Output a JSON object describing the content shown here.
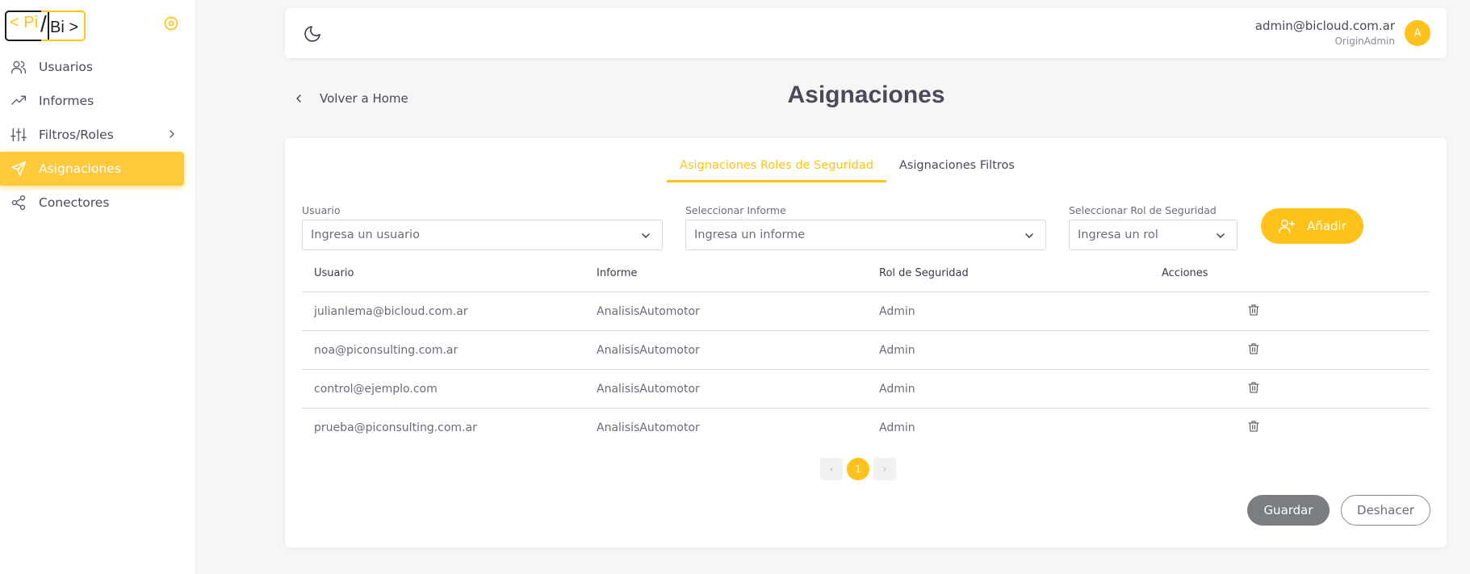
{
  "brand": {
    "logo_left": "< Pi",
    "logo_slash": "/",
    "logo_right": "Bi >",
    "accent_color": "#ffc21a"
  },
  "sidebar": {
    "items": [
      {
        "label": "Usuarios",
        "icon": "users-icon"
      },
      {
        "label": "Informes",
        "icon": "trending-up-icon"
      },
      {
        "label": "Filtros/Roles",
        "icon": "sliders-icon",
        "has_submenu": true
      },
      {
        "label": "Asignaciones",
        "icon": "send-icon",
        "active": true
      },
      {
        "label": "Conectores",
        "icon": "share-icon"
      }
    ]
  },
  "header": {
    "user_email": "admin@bicloud.com.ar",
    "user_role": "OriginAdmin",
    "avatar_initial": "A"
  },
  "page": {
    "back_label": "Volver a Home",
    "title": "Asignaciones"
  },
  "tabs": [
    {
      "label": "Asignaciones Roles de Seguridad",
      "active": true
    },
    {
      "label": "Asignaciones Filtros",
      "active": false
    }
  ],
  "filters": {
    "user": {
      "label": "Usuario",
      "placeholder": "Ingresa un usuario"
    },
    "report": {
      "label": "Seleccionar Informe",
      "placeholder": "Ingresa un informe"
    },
    "role": {
      "label": "Seleccionar Rol de Seguridad",
      "placeholder": "Ingresa un rol"
    }
  },
  "add_button_label": "Añadir",
  "table": {
    "headers": [
      "Usuario",
      "Informe",
      "Rol de Seguridad",
      "Acciones"
    ],
    "rows": [
      [
        "julianlema@bicloud.com.ar",
        "AnalisisAutomotor",
        "Admin"
      ],
      [
        "noa@piconsulting.com.ar",
        "AnalisisAutomotor",
        "Admin"
      ],
      [
        "control@ejemplo.com",
        "AnalisisAutomotor",
        "Admin"
      ],
      [
        "prueba@piconsulting.com.ar",
        "AnalisisAutomotor",
        "Admin"
      ]
    ]
  },
  "pagination": {
    "current_page": "1",
    "prev": "‹",
    "next": "›"
  },
  "actions": {
    "save_label": "Guardar",
    "undo_label": "Deshacer"
  }
}
